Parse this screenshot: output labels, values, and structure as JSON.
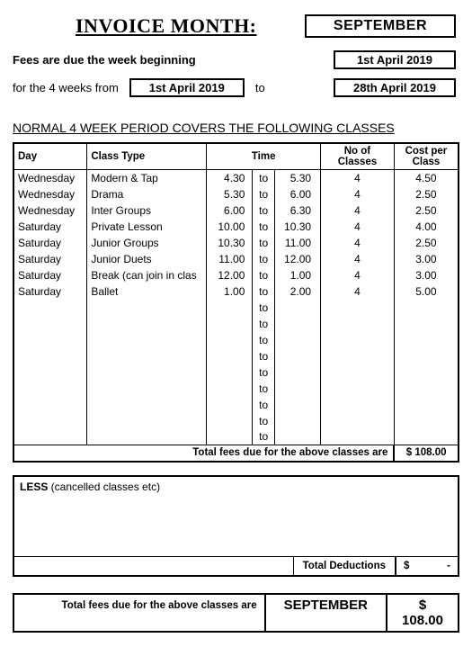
{
  "header": {
    "title_label": "INVOICE MONTH:",
    "month": "SEPTEMBER",
    "due_label": "Fees are due the week beginning",
    "due_date": "1st April 2019",
    "from_label": "for the 4 weeks from",
    "from_date": "1st April 2019",
    "to_label": "to",
    "to_date": "28th April 2019"
  },
  "section_heading": "NORMAL 4 WEEK PERIOD COVERS THE FOLLOWING CLASSES",
  "columns": {
    "day": "Day",
    "class_type": "Class Type",
    "time": "Time",
    "no_classes": "No of Classes",
    "cost": "Cost per Class"
  },
  "to_word": "to",
  "rows": [
    {
      "day": "Wednesday",
      "type": "Modern & Tap",
      "t1": "4.30",
      "t2": "5.30",
      "n": "4",
      "cost": "4.50"
    },
    {
      "day": "Wednesday",
      "type": "Drama",
      "t1": "5.30",
      "t2": "6.00",
      "n": "4",
      "cost": "2.50"
    },
    {
      "day": "Wednesday",
      "type": "Inter Groups",
      "t1": "6.00",
      "t2": "6.30",
      "n": "4",
      "cost": "2.50"
    },
    {
      "day": "Saturday",
      "type": "Private Lesson",
      "t1": "10.00",
      "t2": "10.30",
      "n": "4",
      "cost": "4.00"
    },
    {
      "day": "Saturday",
      "type": "Junior Groups",
      "t1": "10.30",
      "t2": "11.00",
      "n": "4",
      "cost": "2.50"
    },
    {
      "day": "Saturday",
      "type": "Junior Duets",
      "t1": "11.00",
      "t2": "12.00",
      "n": "4",
      "cost": "3.00"
    },
    {
      "day": "Saturday",
      "type": "Break (can join in clas",
      "t1": "12.00",
      "t2": "1.00",
      "n": "4",
      "cost": "3.00"
    },
    {
      "day": "Saturday",
      "type": "Ballet",
      "t1": "1.00",
      "t2": "2.00",
      "n": "4",
      "cost": "5.00"
    }
  ],
  "empty_rows": 9,
  "totals": {
    "above_label": "Total fees due for the above classes are",
    "above_value": "$ 108.00"
  },
  "less": {
    "label_bold": "LESS",
    "label_rest": " (cancelled classes etc)",
    "ded_label": "Total Deductions",
    "ded_currency": "$",
    "ded_value": "-"
  },
  "final": {
    "label": "Total fees due for the above classes are",
    "month": "SEPTEMBER",
    "value": "$ 108.00"
  }
}
